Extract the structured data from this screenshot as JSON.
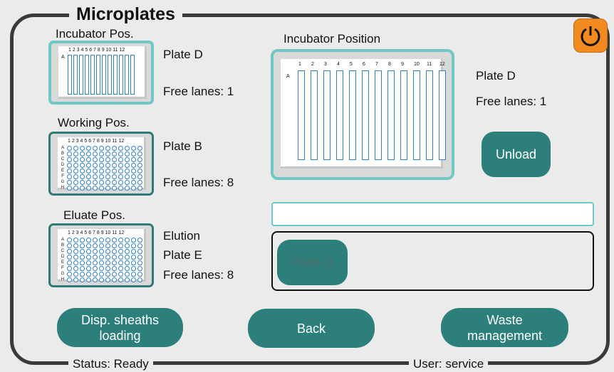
{
  "title": "Microplates",
  "power": {
    "icon": "power-icon",
    "color": "#f38a1f"
  },
  "incubator_small": {
    "label": "Incubator Pos.",
    "plate": "Plate D",
    "free_lanes": "Free lanes: 1",
    "col_numbers": "1 2 3 4 5 6 7 8 9 10 11 12",
    "row_letter": "A"
  },
  "working": {
    "label": "Working Pos.",
    "plate": "Plate B",
    "free_lanes": "Free lanes: 8",
    "col_numbers": "1 2 3 4 5 6 7 8 9 10 11 12",
    "rows": [
      "A",
      "B",
      "C",
      "D",
      "E",
      "F",
      "G",
      "H"
    ]
  },
  "eluate": {
    "label": "Eluate Pos.",
    "line1": "Elution",
    "plate": "Plate E",
    "free_lanes": "Free lanes: 8",
    "col_numbers": "1 2 3 4 5 6 7 8 9 10 11 12",
    "rows": [
      "A",
      "B",
      "C",
      "D",
      "E",
      "F",
      "G",
      "H"
    ]
  },
  "incubator_big": {
    "label": "Incubator Position",
    "plate": "Plate D",
    "free_lanes": "Free lanes: 1",
    "row_letter": "A",
    "cols": [
      "1",
      "2",
      "3",
      "4",
      "5",
      "6",
      "7",
      "8",
      "9",
      "10",
      "11",
      "12"
    ]
  },
  "unload_label": "Unload",
  "text_field_value": "",
  "list_item": "Plate D",
  "buttons": {
    "disp_line1": "Disp. sheaths",
    "disp_line2": "loading",
    "back": "Back",
    "waste_line1": "Waste",
    "waste_line2": "management"
  },
  "status": "Status: Ready",
  "user": "User: service",
  "colors": {
    "accent": "#2d7f7c",
    "selected_border": "#6fc8c5",
    "lane": "#2a7fd0"
  }
}
